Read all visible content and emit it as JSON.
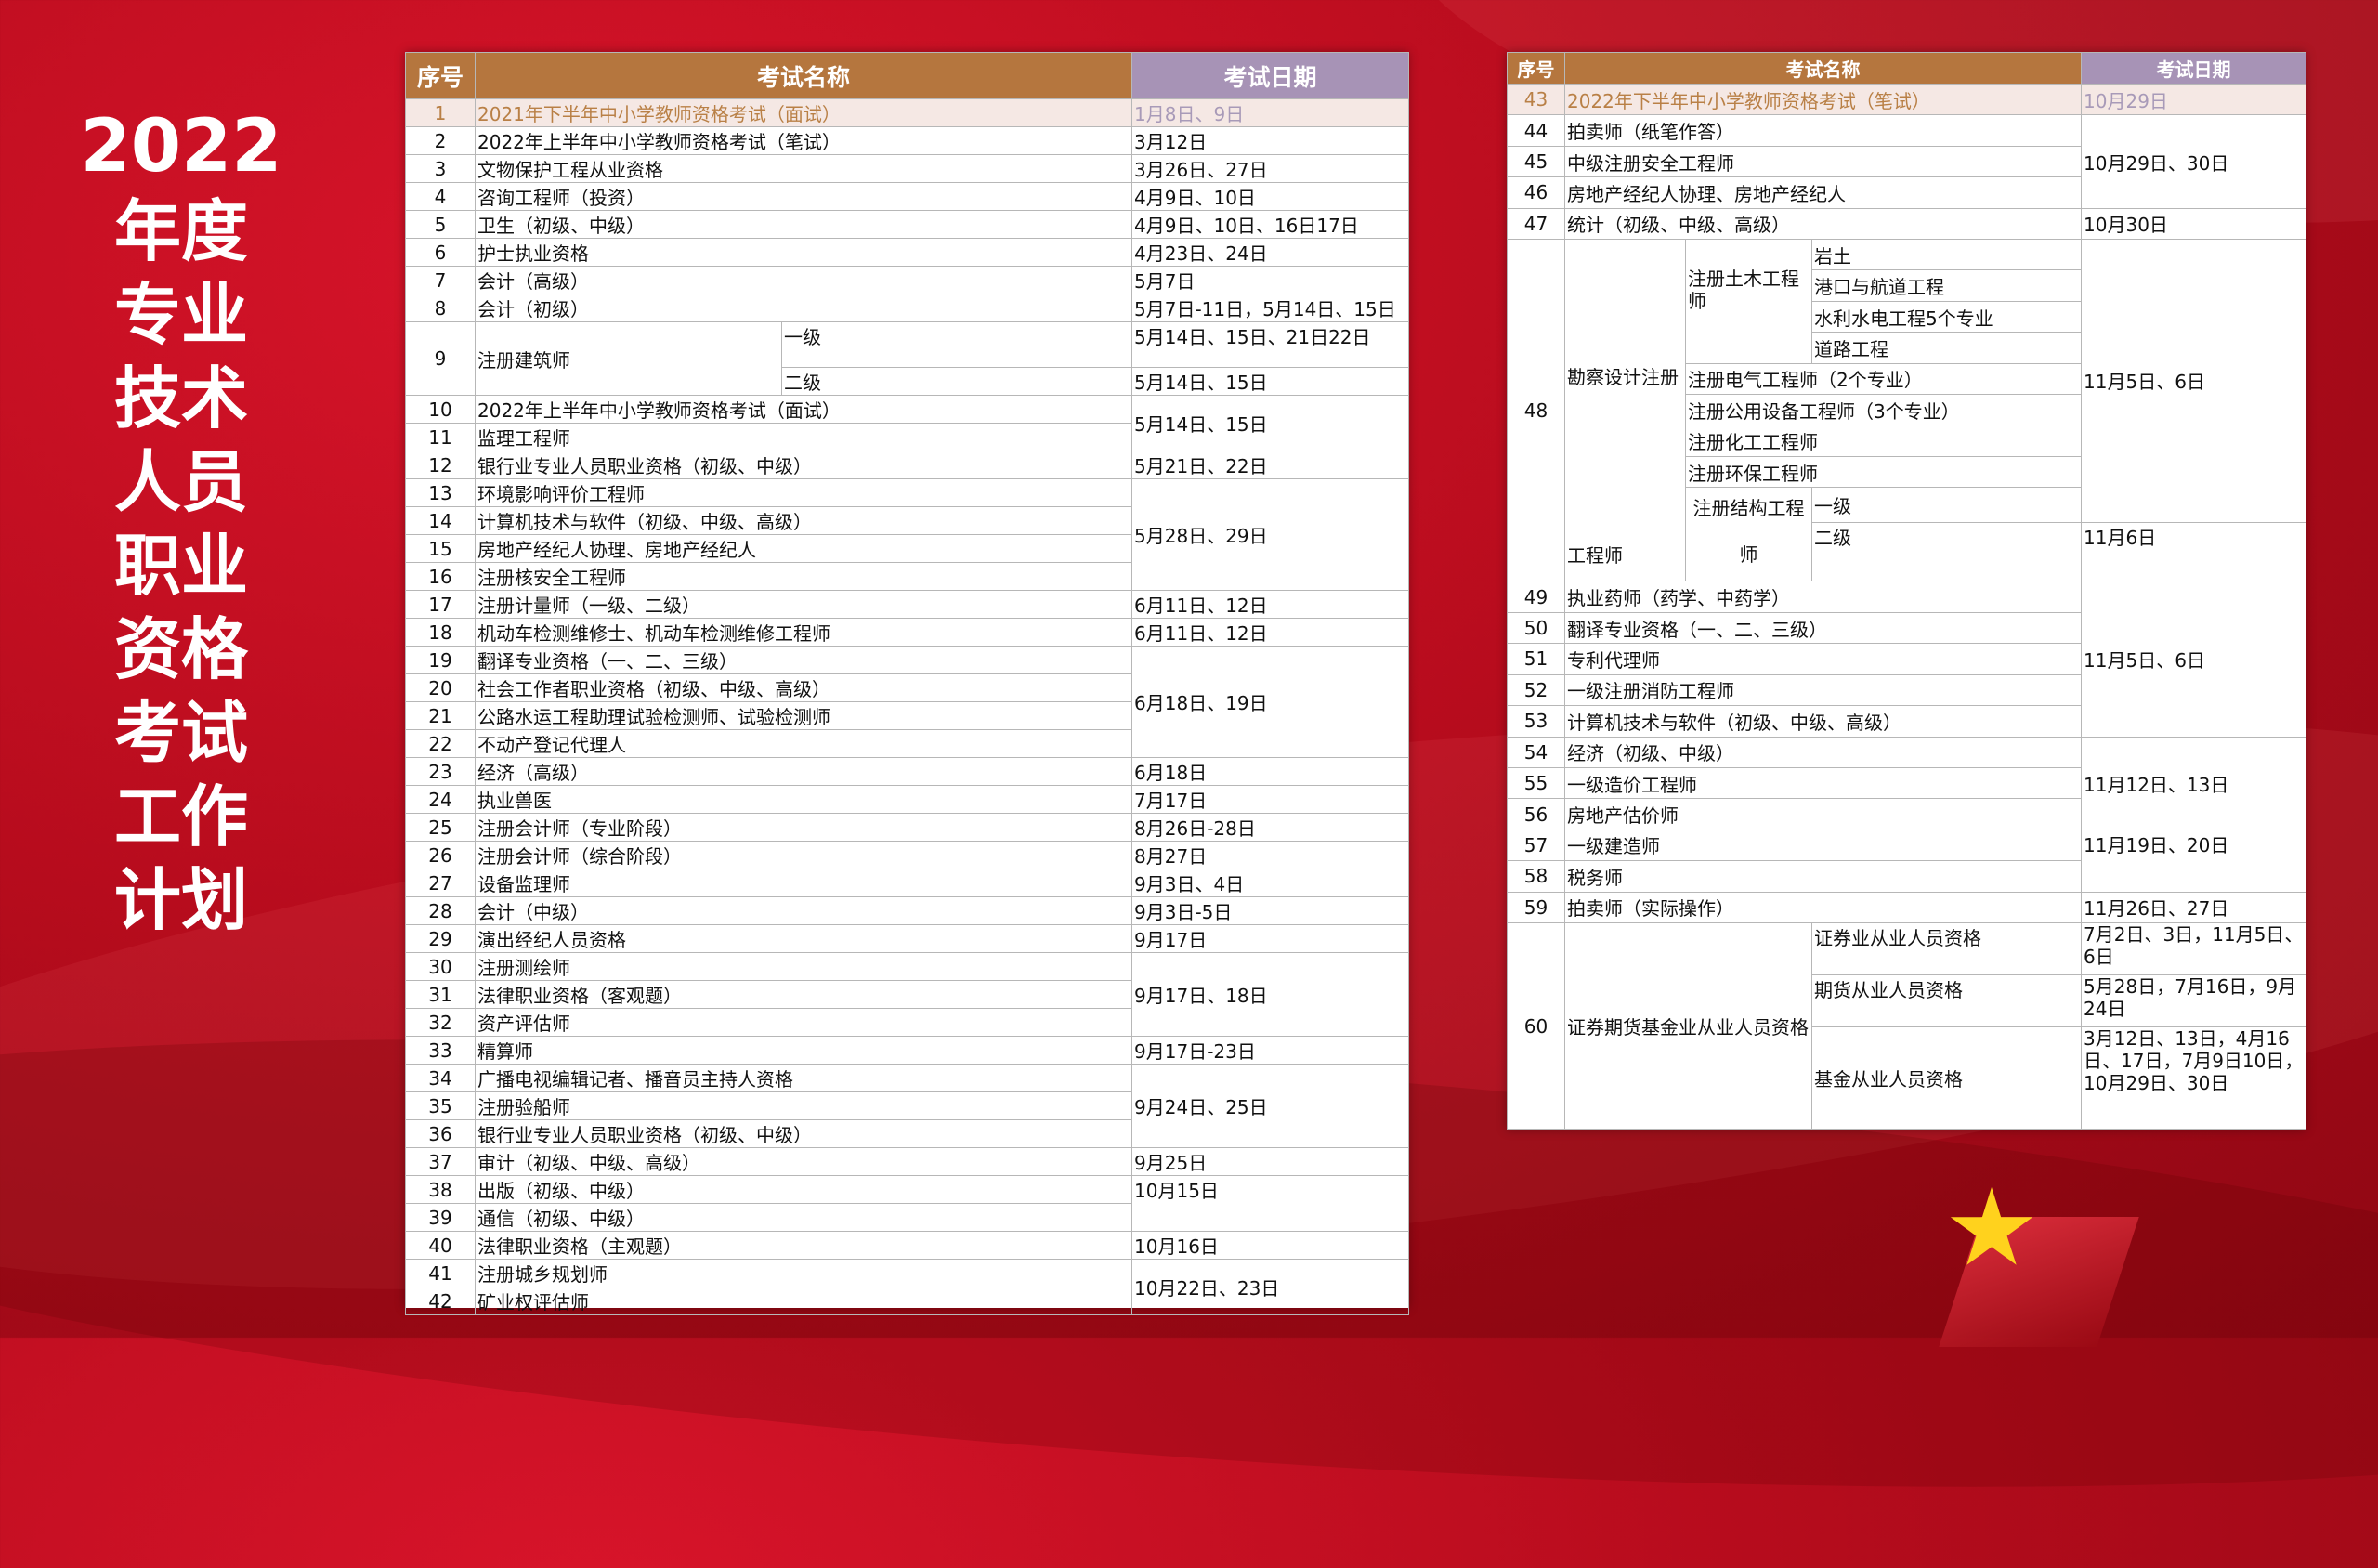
{
  "title": {
    "year": "2022",
    "chars": [
      "年度",
      "专业",
      "技术",
      "人员",
      "职业",
      "资格",
      "考试",
      "工作",
      "计划"
    ]
  },
  "headers": {
    "num": "序号",
    "name": "考试名称",
    "date": "考试日期"
  },
  "a": {
    "r1": [
      "1",
      "2021年下半年中小学教师资格考试（面试）",
      "1月8日、9日"
    ],
    "r2": [
      "2",
      "2022年上半年中小学教师资格考试（笔试）",
      "3月12日"
    ],
    "r3": [
      "3",
      "文物保护工程从业资格",
      "3月26日、27日"
    ],
    "r4": [
      "4",
      "咨询工程师（投资）",
      "4月9日、10日"
    ],
    "r5": [
      "5",
      "卫生（初级、中级）",
      "4月9日、10日、16日17日"
    ],
    "r6": [
      "6",
      "护士执业资格",
      "4月23日、24日"
    ],
    "r7": [
      "7",
      "会计（高级）",
      "5月7日"
    ],
    "r8": [
      "8",
      "会计（初级）",
      "5月7日-11日，5月14日、15日"
    ],
    "r9": {
      "n": "9",
      "name": "注册建筑师",
      "s1": "一级",
      "s2": "二级",
      "d1": "5月14日、15日、21日22日",
      "d2": "5月14日、15日"
    },
    "r10": [
      "10",
      "2022年上半年中小学教师资格考试（面试）"
    ],
    "r11": [
      "11",
      "监理工程师"
    ],
    "d10_11": "5月14日、15日",
    "r12": [
      "12",
      "银行业专业人员职业资格（初级、中级）",
      "5月21日、22日"
    ],
    "r13": [
      "13",
      "环境影响评价工程师"
    ],
    "r14": [
      "14",
      "计算机技术与软件（初级、中级、高级）"
    ],
    "r15": [
      "15",
      "房地产经纪人协理、房地产经纪人"
    ],
    "r16": [
      "16",
      "注册核安全工程师"
    ],
    "d13_16": "5月28日、29日",
    "r17": [
      "17",
      "注册计量师（一级、二级）",
      "6月11日、12日"
    ],
    "r18": [
      "18",
      "机动车检测维修士、机动车检测维修工程师",
      "6月11日、12日"
    ],
    "r19": [
      "19",
      "翻译专业资格（一、二、三级）"
    ],
    "r20": [
      "20",
      "社会工作者职业资格（初级、中级、高级）"
    ],
    "r21": [
      "21",
      "公路水运工程助理试验检测师、试验检测师"
    ],
    "r22": [
      "22",
      "不动产登记代理人"
    ],
    "d19_22": "6月18日、19日",
    "r23": [
      "23",
      "经济（高级）",
      "6月18日"
    ],
    "r24": [
      "24",
      "执业兽医",
      "7月17日"
    ],
    "r25": [
      "25",
      "注册会计师（专业阶段）",
      "8月26日-28日"
    ],
    "r26": [
      "26",
      "注册会计师（综合阶段）",
      "8月27日"
    ],
    "r27": [
      "27",
      "设备监理师",
      "9月3日、4日"
    ],
    "r28": [
      "28",
      "会计（中级）",
      "9月3日-5日"
    ],
    "r29": [
      "29",
      "演出经纪人员资格",
      "9月17日"
    ],
    "r30": [
      "30",
      "注册测绘师"
    ],
    "r31": [
      "31",
      "法律职业资格（客观题）"
    ],
    "r32": [
      "32",
      "资产评估师"
    ],
    "d30_32": "9月17日、18日",
    "r33": [
      "33",
      "精算师",
      "9月17日-23日"
    ],
    "r34": [
      "34",
      "广播电视编辑记者、播音员主持人资格"
    ],
    "r35": [
      "35",
      "注册验船师"
    ],
    "r36": [
      "36",
      "银行业专业人员职业资格（初级、中级）"
    ],
    "d34_36": "9月24日、25日",
    "r37": [
      "37",
      "审计（初级、中级、高级）",
      "9月25日"
    ],
    "r38": [
      "38",
      "出版（初级、中级）"
    ],
    "r39": [
      "39",
      "通信（初级、中级）"
    ],
    "d38_39": "10月15日",
    "r40": [
      "40",
      "法律职业资格（主观题）",
      "10月16日"
    ],
    "r41": [
      "41",
      "注册城乡规划师"
    ],
    "r42": [
      "42",
      "矿业权评估师"
    ],
    "d41_42": "10月22日、23日"
  },
  "b": {
    "r43": [
      "43",
      "2022年下半年中小学教师资格考试（笔试）",
      "10月29日"
    ],
    "r44": [
      "44",
      "拍卖师（纸笔作答）"
    ],
    "r45": [
      "45",
      "中级注册安全工程师"
    ],
    "r46": [
      "46",
      "房地产经纪人协理、房地产经纪人"
    ],
    "d44_46": "10月29日、30日",
    "r47": [
      "47",
      "统计（初级、中级、高级）",
      "10月30日"
    ],
    "r48": {
      "n": "48",
      "main1": "勘察设计注册",
      "main2": "工程师",
      "civil": "注册土木工程师",
      "civil_items": [
        "岩土",
        "港口与航道工程",
        "水利水电工程5个专业",
        "道路工程"
      ],
      "elec": "注册电气工程师（2个专业）",
      "util": "注册公用设备工程师（3个专业）",
      "chem": "注册化工工程师",
      "env": "注册环保工程师",
      "struct1": "注册结构工程",
      "struct2": "师",
      "lv1": "一级",
      "lv2": "二级",
      "d1": "11月5日、6日",
      "d2": "11月6日"
    },
    "r49": [
      "49",
      "执业药师（药学、中药学）"
    ],
    "r50": [
      "50",
      "翻译专业资格（一、二、三级）"
    ],
    "r51": [
      "51",
      "专利代理师"
    ],
    "r52": [
      "52",
      "一级注册消防工程师"
    ],
    "r53": [
      "53",
      "计算机技术与软件（初级、中级、高级）"
    ],
    "d49_53": "11月5日、6日",
    "r54": [
      "54",
      "经济（初级、中级）"
    ],
    "r55": [
      "55",
      "一级造价工程师"
    ],
    "r56": [
      "56",
      "房地产估价师"
    ],
    "d54_56": "11月12日、13日",
    "r57": [
      "57",
      "一级建造师"
    ],
    "r58": [
      "58",
      "税务师"
    ],
    "d57_58": "11月19日、20日",
    "r59": [
      "59",
      "拍卖师（实际操作）",
      "11月26日、27日"
    ],
    "r60": {
      "n": "60",
      "name": "证券期货基金业从业人员资格",
      "s1": "证券业从业人员资格",
      "d1": "7月2日、3日，11月5日、6日",
      "s2": "期货从业人员资格",
      "d2": "5月28日，7月16日，9月24日",
      "s3": "基金从业人员资格",
      "d3": "3月12日、13日，4月16日、17日，7月9日10日，10月29日、30日"
    }
  }
}
